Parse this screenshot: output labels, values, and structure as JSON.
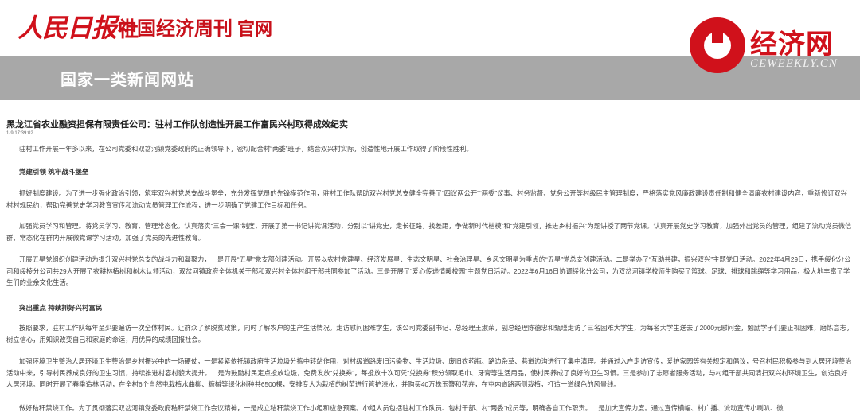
{
  "header": {
    "rmrb_logo": "人民日报",
    "rmrb_she": "社",
    "ceweekly_name": "中国经济周刊",
    "ceweekly_gw": "官网",
    "banner_title": "国家一类新闻网站",
    "jjw_name": "经济网",
    "jjw_en": "CEWEEKLY.CN"
  },
  "article": {
    "title": "黑龙江省农业融资担保有限责任公司：驻村工作队创造性开展工作富民兴村取得成效纪实",
    "time": "1-9 17:39:02",
    "p1": "驻村工作开展一年多以来，在公司党委和双岔河镇党委政府的正确领导下，密切配合村“两委”班子，结合双兴村实际，创造性地开展工作取得了阶段性胜利。",
    "h1": "党建引领 筑牢战斗堡垒",
    "p2": "抓好制度建设。为了进一步强化政治引领，筑牢双兴村党总支战斗堡垒，充分发挥党员的先锋模范作用，驻村工作队帮助双兴村党总支健全完善了“四议两公开”“两委”议事、村务监督、党务公开等村级民主管理制度，严格落实党风廉政建设责任制和健全清廉农村建设内容，重新修订双兴村村规民约，帮助完善党史学习教育宣传和流动党员管理工作流程，进一步明确了党建工作目标和任务。",
    "p3": "加强党员学习和管理。将党员学习、教育、管理常态化。认真落实“三会一课”制度，开展了第一书记讲党课活动，分别以“讲党史，走长征路，找差距，争做新时代楷模”和“党建引领，推进乡村振兴”为题讲授了两节党课。认真开展党史学习教育，加强外出党员的管理，组建了流动党员微信群，常态化在群内开展微党课学习活动，加强了党员的先进性教育。",
    "p4": "开展五星党组织创建活动为提升双兴村党总支的战斗力和凝聚力，一是开展“五星”党支部创建活动。开展以农村党建星、经济发展星、生态文明星、社会治理星、乡风文明星为重点的“五星”党总支创建活动。二是举办了“互助共建，振兴双兴”主题党日活动。2022年4月29日，携手绥化分公司和绥棱分公司共29人开展了农耕林植树和树木认领活动，双岔河镇政府全体机关干部和双兴村全体村组干部共同参加了活动。三是开展了“爱心传递情暖校园”主题党日活动。2022年6月16日协调绥化分公司，为双岔河镇学校师生购买了篮球、足球、排球和跳绳等学习用品，极大地丰富了学生们的业余文化生活。",
    "h2": "突出重点 持续抓好兴村富民",
    "p5": "按照要求，驻村工作队每年至少要遍访一次全体村民。让群众了解脱贫政策，同时了解农户的生产生活情况。走访慰问困难学生，该公司党委副书记、总经理王淑荣，副总经理陈德忠和甄瑾走访了三名困难大学生，为每名大学生送去了2000元慰问金，勉励学子们要正视困难，磨炼意志，树立信心，用知识改变自己和家庭的命运，用优异的成绩回报社会。",
    "p6": "加强环境卫生整治人居环境卫生整治是乡村振兴中的一场硬仗，一是紧紧依托镇政府生活垃圾分拣中转站作用，对村级道路废旧污染物、生活垃圾、废旧农药瓶、路边杂草、巷道边沟进行了集中清理。并通过入户走访宣传，爱护家园等有关规定和倡议，号召村民积极参与到人居环境整治活动中来，引导村民养成良好的卫生习惯，持续推进村容村貌大提升。二是为鼓励村民定点投放垃圾，免费发放“兑换券”，每投放十次可凭“兑换券”积分领取毛巾、牙膏等生活用品，使村民养成了良好的卫生习惯。三是参加了志愿者服务活动，与村组干部共同清扫双兴村环境卫生，创造良好人居环境。同时开展了春季造林活动，在全村6个自然屯栽植水曲柳、糖槭等绿化树种共6500棵，安排专人为栽植的树苗进行管护浇水，并购买40万株玉簪和花卉，在屯内道路两侧栽植，打造一道绿色的风景线。",
    "p7": "做好秸秆禁烧工作。为了贯彻落实双岔河镇党委政府秸秆禁烧工作会议精神，一是成立秸秆禁烧工作小组和应急预案。小组人员包括驻村工作队员、包村干部、村“两委”成员等，明确各自工作职责。二是加大宣传力度。通过宣传横幅、村广播、流动宣传小喇叭、微"
  }
}
